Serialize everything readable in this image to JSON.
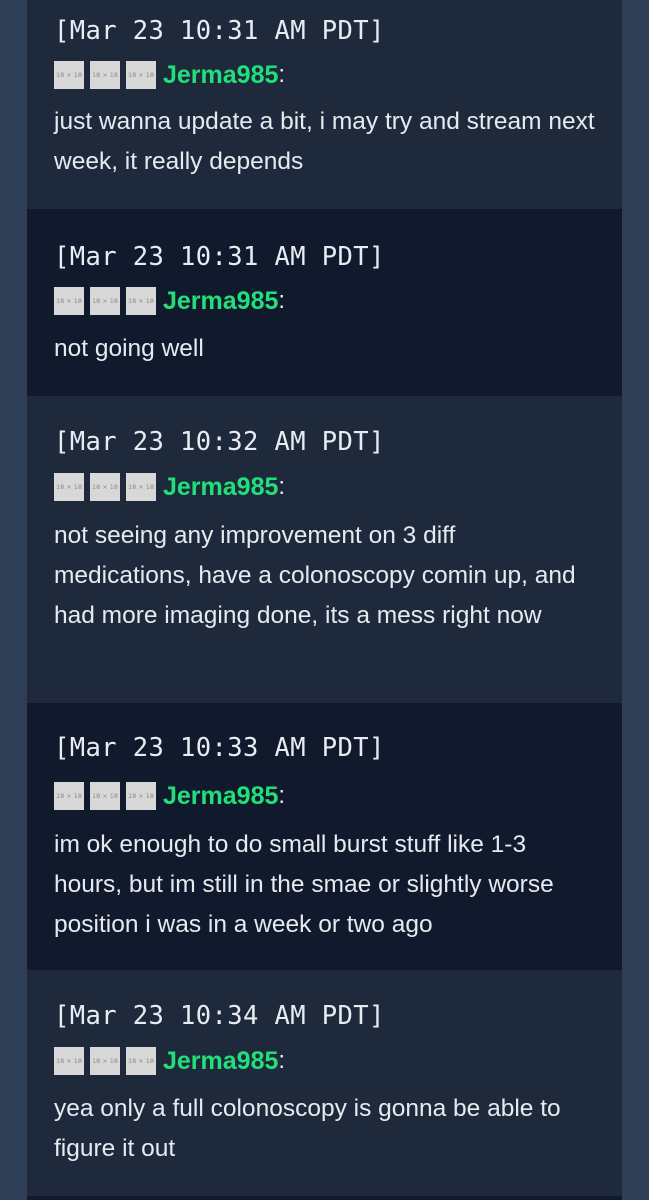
{
  "messages": [
    {
      "timestamp": "[Mar 23 10:31 AM PDT]",
      "badges": [
        "18 × 18",
        "18 × 18",
        "18 × 18"
      ],
      "username": "Jerma985",
      "colon": ":",
      "text": "just wanna update a bit, i may try and stream next week, it really depends"
    },
    {
      "timestamp": "[Mar 23 10:31 AM PDT]",
      "badges": [
        "18 × 18",
        "18 × 18",
        "18 × 18"
      ],
      "username": "Jerma985",
      "colon": ":",
      "text": "not going well"
    },
    {
      "timestamp": "[Mar 23 10:32 AM PDT]",
      "badges": [
        "18 × 18",
        "18 × 18",
        "18 × 18"
      ],
      "username": "Jerma985",
      "colon": ":",
      "text": "not seeing any improvement on 3 diff medications, have a colonoscopy comin up, and had more imaging done, its a mess right now"
    },
    {
      "timestamp": "[Mar 23 10:33 AM PDT]",
      "badges": [
        "18 × 18",
        "18 × 18",
        "18 × 18"
      ],
      "username": "Jerma985",
      "colon": ":",
      "text": "im ok enough to do small burst stuff like 1-3 hours, but im still in the smae or slightly worse position i was in a week or two ago"
    },
    {
      "timestamp": "[Mar 23 10:34 AM PDT]",
      "badges": [
        "18 × 18",
        "18 × 18",
        "18 × 18"
      ],
      "username": "Jerma985",
      "colon": ":",
      "text": "yea only a full colonoscopy is gonna be able to figure it out"
    }
  ],
  "colors": {
    "page_background": "#2e3f55",
    "message_light": "#1e2a3c",
    "message_dark": "#111a2c",
    "username": "#21e07a",
    "text": "#e6eaf0"
  }
}
